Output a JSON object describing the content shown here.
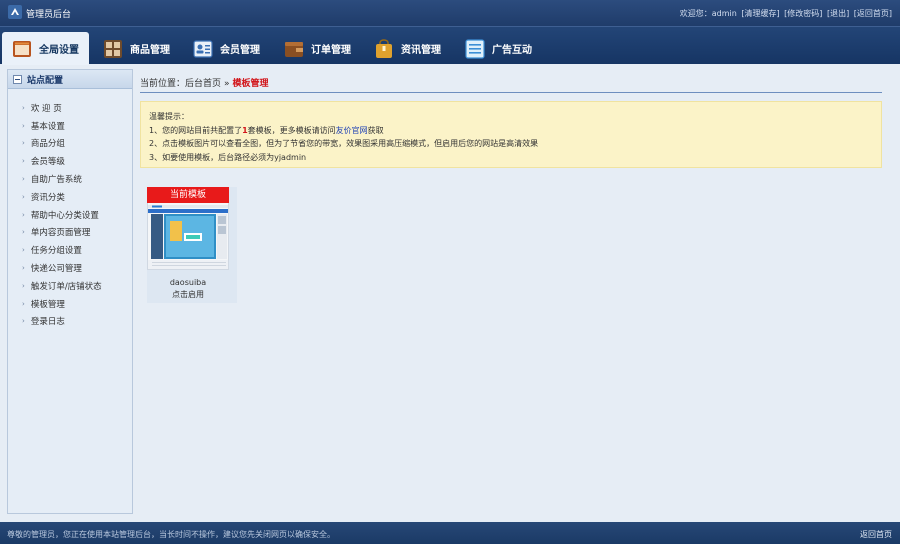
{
  "topbar": {
    "title": "管理员后台",
    "welcome": "欢迎您：admin",
    "links": [
      "[清理缓存]",
      "[修改密码]",
      "[退出]",
      "[返回首页]"
    ]
  },
  "nav": {
    "items": [
      {
        "label": "全局设置",
        "icon": "settings-icon",
        "active": true,
        "color": "#c0552a"
      },
      {
        "label": "商品管理",
        "icon": "grid-icon",
        "active": false,
        "color": "#8a5a34"
      },
      {
        "label": "会员管理",
        "icon": "member-card-icon",
        "active": false,
        "color": "#3a6fb3"
      },
      {
        "label": "订单管理",
        "icon": "wallet-icon",
        "active": false,
        "color": "#a0602a"
      },
      {
        "label": "资讯管理",
        "icon": "bag-icon",
        "active": false,
        "color": "#d69a2c"
      },
      {
        "label": "广告互动",
        "icon": "list-icon",
        "active": false,
        "color": "#3c8fd6"
      }
    ]
  },
  "sidebar": {
    "heading": "站点配置",
    "items": [
      "欢 迎 页",
      "基本设置",
      "商品分组",
      "会员等级",
      "自助广告系统",
      "资讯分类",
      "帮助中心分类设置",
      "单内容页面管理",
      "任务分组设置",
      "快递公司管理",
      "触发订单/店铺状态",
      "模板管理",
      "登录日志"
    ]
  },
  "breadcrumb": {
    "prefix": "当前位置：",
    "home": "后台首页",
    "separator": "»",
    "current": "模板管理"
  },
  "tip": {
    "title": "温馨提示：",
    "line1_a": "1、您的网站目前共配置了",
    "line1_count": "1",
    "line1_b": "套模板，更多模板请访问",
    "line1_link": "友价官网",
    "line1_c": "获取",
    "line2": "2、点击模板图片可以查看全图，但为了节省您的带宽，效果图采用高压缩模式，但启用后您的网站是高清效果",
    "line3": "3、如要使用模板，后台路径必须为yjadmin"
  },
  "template": {
    "badge": "当前模板",
    "name": "daosuiba",
    "action": "点击启用"
  },
  "footer": {
    "message": "尊敬的管理员，您正在使用本站管理后台，当长时间不操作，建议您先关闭网页以确保安全。",
    "back": "返回首页"
  },
  "colors": {
    "accent_red": "#d2161b",
    "nav_bg": "#1f3c6a",
    "tip_bg": "#fbf3c8"
  }
}
